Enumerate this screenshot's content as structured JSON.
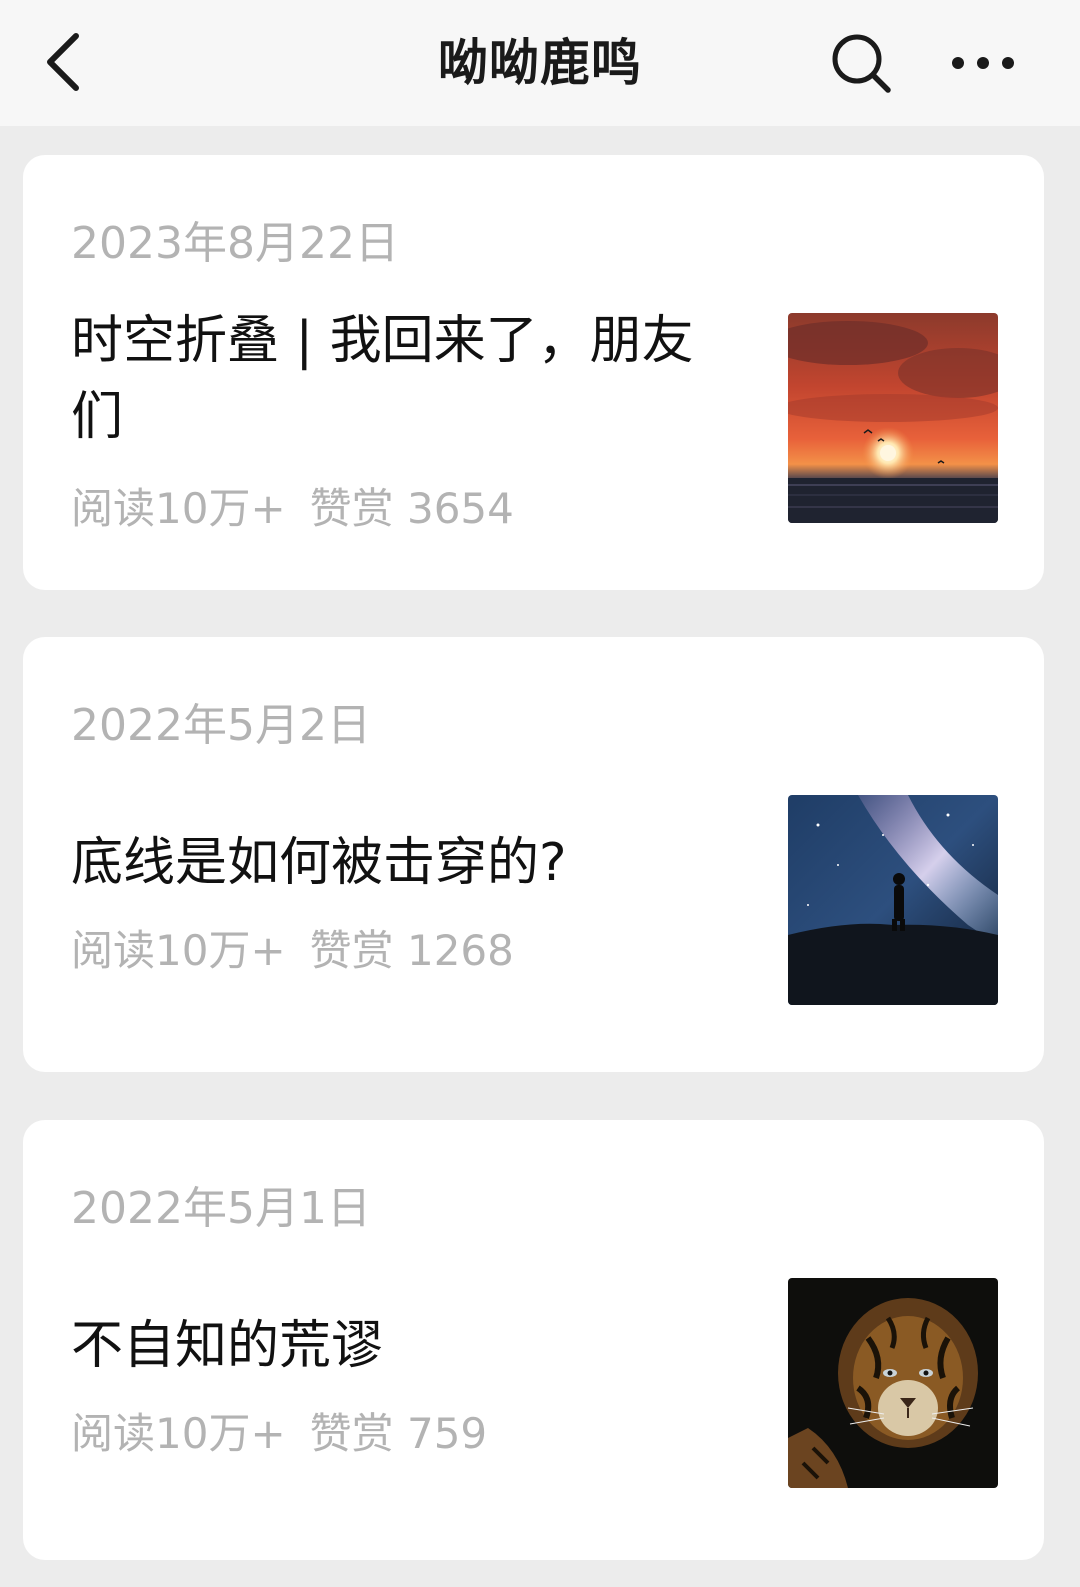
{
  "header": {
    "title": "呦呦鹿鸣",
    "back_icon": "chevron-left-icon",
    "search_icon": "search-icon",
    "more_icon": "more-horizontal-icon"
  },
  "articles": [
    {
      "date": "2023年8月22日",
      "title": "时空折叠 | 我回来了，朋友们",
      "reads": "阅读10万+",
      "tips": "赞赏 3654",
      "thumbnail": "sunset-over-sea-image"
    },
    {
      "date": "2022年5月2日",
      "title": "底线是如何被击穿的?",
      "reads": "阅读10万+",
      "tips": "赞赏 1268",
      "thumbnail": "person-under-milky-way-image"
    },
    {
      "date": "2022年5月1日",
      "title": "不自知的荒谬",
      "reads": "阅读10万+",
      "tips": "赞赏 759",
      "thumbnail": "tiger-portrait-image"
    }
  ],
  "colors": {
    "background": "#ececec",
    "card": "#ffffff",
    "header": "#f7f7f7",
    "title_text": "#111111",
    "secondary_text": "#b3b3b3"
  }
}
